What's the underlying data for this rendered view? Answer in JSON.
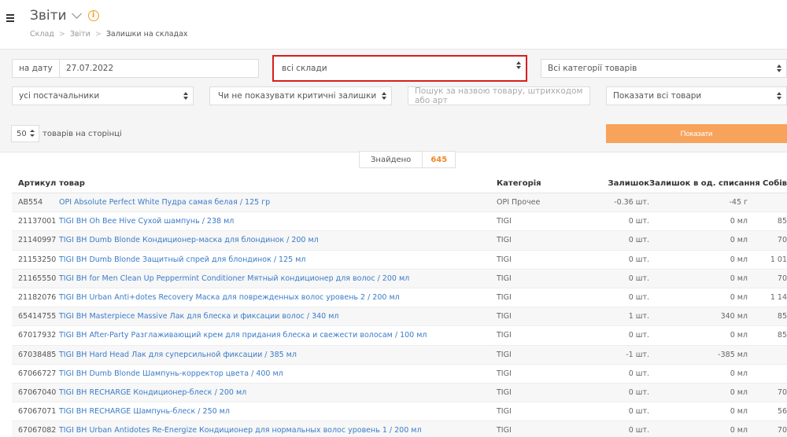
{
  "header": {
    "title": "Звіти",
    "breadcrumb": [
      "Склад",
      "Звіти",
      "Залишки на складах"
    ]
  },
  "filters": {
    "date_label": "на дату",
    "date_value": "27.07.2022",
    "warehouse": "всі склади",
    "category": "Всі категорії товарів",
    "supplier": "усі постачальники",
    "critical": "Чи не показувати критичні залишки",
    "search_placeholder": "Пошук за назвою товару, штрихкодом або арт",
    "show_goods": "Показати всі товари",
    "per_page_value": "50",
    "per_page_label": "товарів на сторінці",
    "show_button": "Показати"
  },
  "found": {
    "label": "Знайдено",
    "count": "645"
  },
  "table": {
    "headers": [
      "Артикул",
      "товар",
      "Категорія",
      "Залишок",
      "Залишок в од. списання",
      "Собів"
    ],
    "rows": [
      [
        "AB554",
        "OPI Absolute Perfect White Пудра самая белая / 125 гр",
        "OPI Прочее",
        "-0.36 шт.",
        "-45 г",
        ""
      ],
      [
        "21137001",
        "TIGI BH Oh Bee Hive Сухой шампунь / 238 мл",
        "TIGI",
        "0 шт.",
        "0 мл",
        "85"
      ],
      [
        "21140997",
        "TIGI BH Dumb Blonde Кондиционер-маска для блондинок / 200 мл",
        "TIGI",
        "0 шт.",
        "0 мл",
        "70"
      ],
      [
        "21153250",
        "TIGI BH Dumb Blonde Защитный спрей для блондинок / 125 мл",
        "TIGI",
        "0 шт.",
        "0 мл",
        "1 01"
      ],
      [
        "21165550",
        "TIGI BH for Men Clean Up Peppermint Conditioner Мятный кондиционер для волос / 200 мл",
        "TIGI",
        "0 шт.",
        "0 мл",
        "70"
      ],
      [
        "21182076",
        "TIGI BH Urban Anti+dotes Recovery Маска для поврежденных волос уровень 2 / 200 мл",
        "TIGI",
        "0 шт.",
        "0 мл",
        "1 14"
      ],
      [
        "65414755",
        "TIGI BH Masterpiece Massive Лак для блеска и фиксации волос / 340 мл",
        "TIGI",
        "1 шт.",
        "340 мл",
        "85"
      ],
      [
        "67017932",
        "TIGI BH After-Party Разглаживающий крем для придания блеска и свежести волосам / 100 мл",
        "TIGI",
        "0 шт.",
        "0 мл",
        "85"
      ],
      [
        "67038485",
        "TIGI BH Hard Head Лак для суперсильной фиксации / 385 мл",
        "TIGI",
        "-1 шт.",
        "-385 мл",
        ""
      ],
      [
        "67066727",
        "TIGI BH Dumb Blonde Шампунь-корректор цвета / 400 мл",
        "TIGI",
        "0 шт.",
        "0 мл",
        ""
      ],
      [
        "67067040",
        "TIGI BH RECHARGE Кондиционер-блеск / 200 мл",
        "TIGI",
        "0 шт.",
        "0 мл",
        "70"
      ],
      [
        "67067071",
        "TIGI BH RECHARGE Шампунь-блеск / 250 мл",
        "TIGI",
        "0 шт.",
        "0 мл",
        "56"
      ],
      [
        "67067082",
        "TIGI BH Urban Antidotes Re-Energize Кондиционер для нормальных волос уровень 1 / 200 мл",
        "TIGI",
        "0 шт.",
        "0 мл",
        "70"
      ]
    ]
  }
}
